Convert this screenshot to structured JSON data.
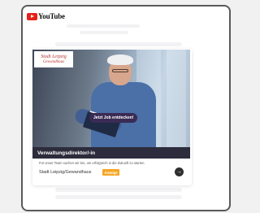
{
  "app": {
    "logo_text": "YouTube"
  },
  "ad": {
    "advertiser_logo": {
      "line1": "Stadt Leipzig",
      "line2": "Gewandhaus"
    },
    "cta_label": "Jetzt Job entdecken!",
    "title": "Verwaltungsdirektor/-in",
    "description": "Für unser Team suchen wir Sie, um erfolgreich in die Zukunft zu starten.",
    "advertiser_name": "Stadt Leipzig/Gewandhaus",
    "badge_label": "Anzeige",
    "arrow_icon": "arrow-right-icon"
  },
  "colors": {
    "title_bar": "#2c2c3c",
    "badge": "#f5a623",
    "cta": "#3a2b55",
    "yt_red": "#e62117"
  }
}
